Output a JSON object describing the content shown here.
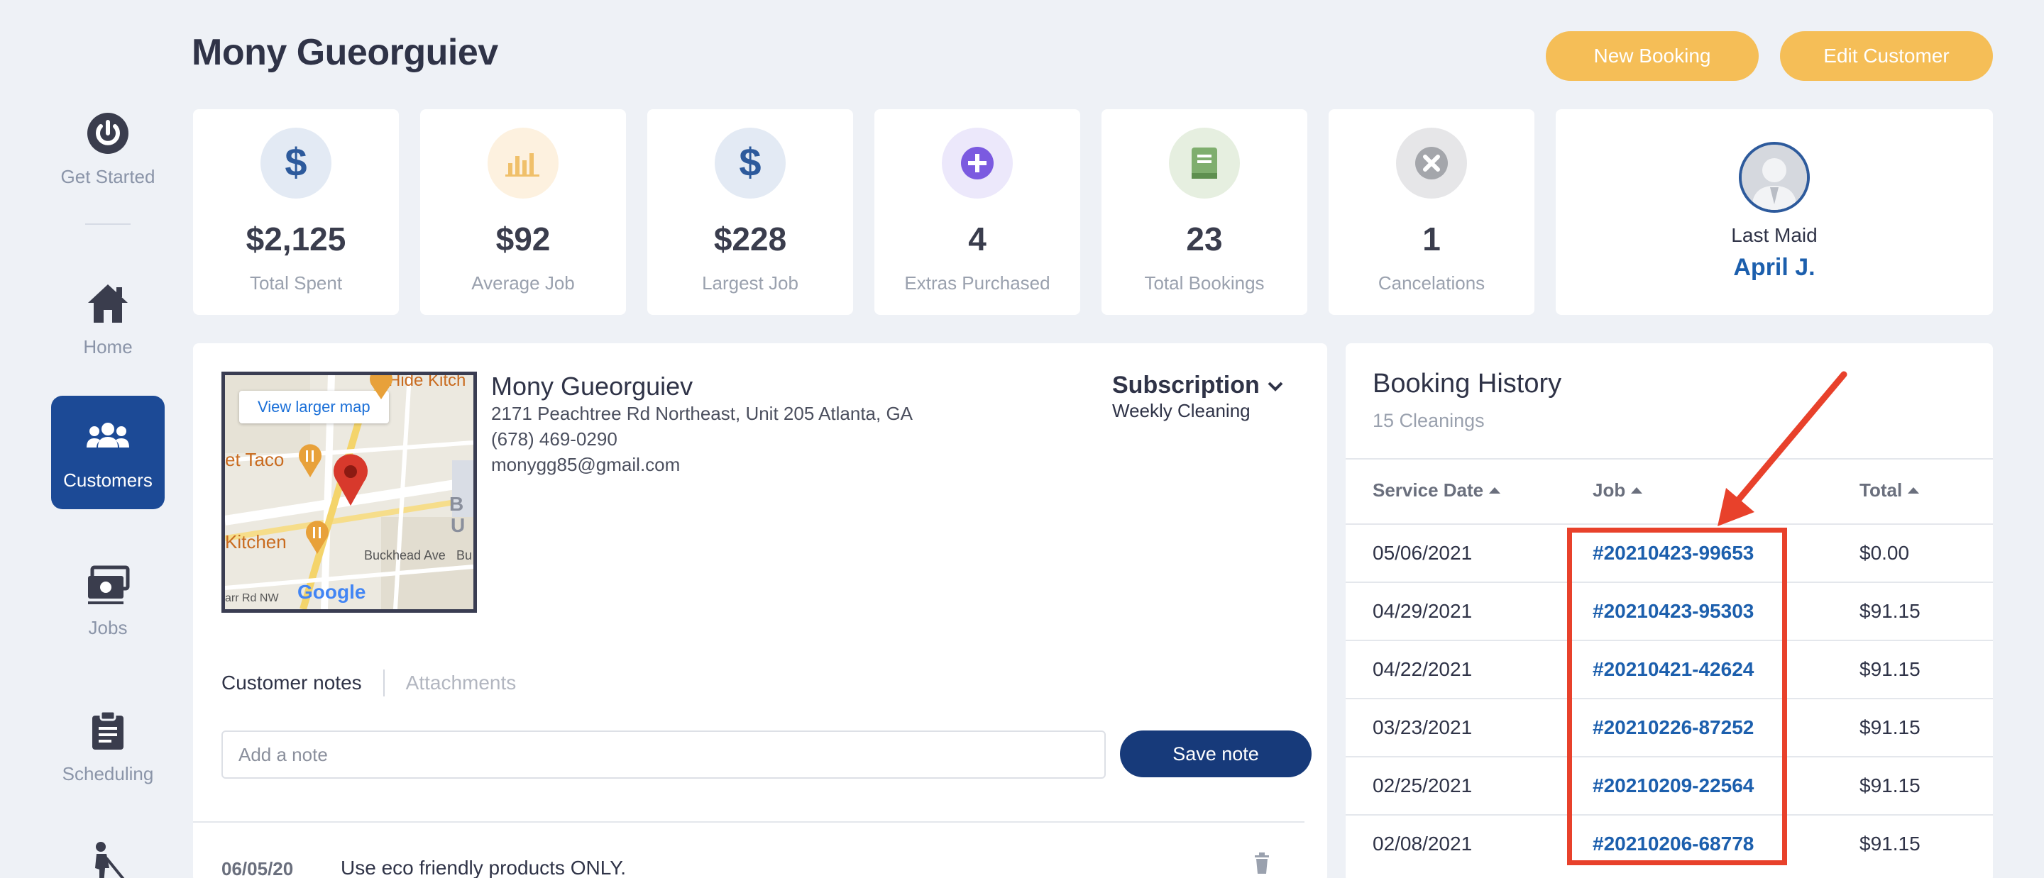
{
  "sidebar": {
    "items": [
      {
        "label": "Get Started",
        "icon": "power-icon"
      },
      {
        "label": "Home",
        "icon": "house-icon"
      },
      {
        "label": "Customers",
        "icon": "users-icon"
      },
      {
        "label": "Jobs",
        "icon": "money-icon"
      },
      {
        "label": "Scheduling",
        "icon": "clipboard-icon"
      },
      {
        "label": "",
        "icon": "cleaner-icon"
      }
    ],
    "active": "Customers",
    "active_color": "#1c4a96"
  },
  "header": {
    "title": "Mony Gueorguiev",
    "new_booking_label": "New Booking",
    "edit_customer_label": "Edit Customer",
    "button_color": "#f5be57"
  },
  "stats": [
    {
      "value": "$2,125",
      "label": "Total Spent",
      "icon": "dollar-icon"
    },
    {
      "value": "$92",
      "label": "Average Job",
      "icon": "bar-chart-icon"
    },
    {
      "value": "$228",
      "label": "Largest Job",
      "icon": "dollar-icon"
    },
    {
      "value": "4",
      "label": "Extras Purchased",
      "icon": "plus-circle-icon"
    },
    {
      "value": "23",
      "label": "Total Bookings",
      "icon": "book-icon"
    },
    {
      "value": "1",
      "label": "Cancelations",
      "icon": "x-circle-icon"
    }
  ],
  "last_maid": {
    "label": "Last Maid",
    "name": "April J."
  },
  "customer": {
    "name": "Mony Gueorguiev",
    "address": "2171 Peachtree Rd Northeast, Unit 205 Atlanta, GA",
    "phone": "(678) 469-0290",
    "email": "monygg85@gmail.com",
    "subscription_label": "Subscription",
    "subscription_value": "Weekly Cleaning",
    "map": {
      "link_label": "View larger map",
      "labels": [
        "Hide Kitch",
        "et Taco",
        "Kitchen",
        "Buckhead Ave",
        "arr Rd NW",
        "B",
        "U",
        "Bu"
      ],
      "brand": "Google"
    }
  },
  "notes": {
    "tab_notes": "Customer notes",
    "tab_attachments": "Attachments",
    "placeholder": "Add a note",
    "save_label": "Save note",
    "items": [
      {
        "date": "06/05/20",
        "text": "Use eco friendly products ONLY."
      }
    ]
  },
  "booking_history": {
    "title": "Booking History",
    "count": "15 Cleanings",
    "columns": [
      "Service Date",
      "Job",
      "Total"
    ],
    "rows": [
      {
        "date": "05/06/2021",
        "job": "#20210423-99653",
        "total": "$0.00"
      },
      {
        "date": "04/29/2021",
        "job": "#20210423-95303",
        "total": "$91.15"
      },
      {
        "date": "04/22/2021",
        "job": "#20210421-42624",
        "total": "$91.15"
      },
      {
        "date": "03/23/2021",
        "job": "#20210226-87252",
        "total": "$91.15"
      },
      {
        "date": "02/25/2021",
        "job": "#20210209-22564",
        "total": "$91.15"
      },
      {
        "date": "02/08/2021",
        "job": "#20210206-68778",
        "total": "$91.15"
      }
    ]
  },
  "annotation": {
    "color": "#e8412b"
  }
}
